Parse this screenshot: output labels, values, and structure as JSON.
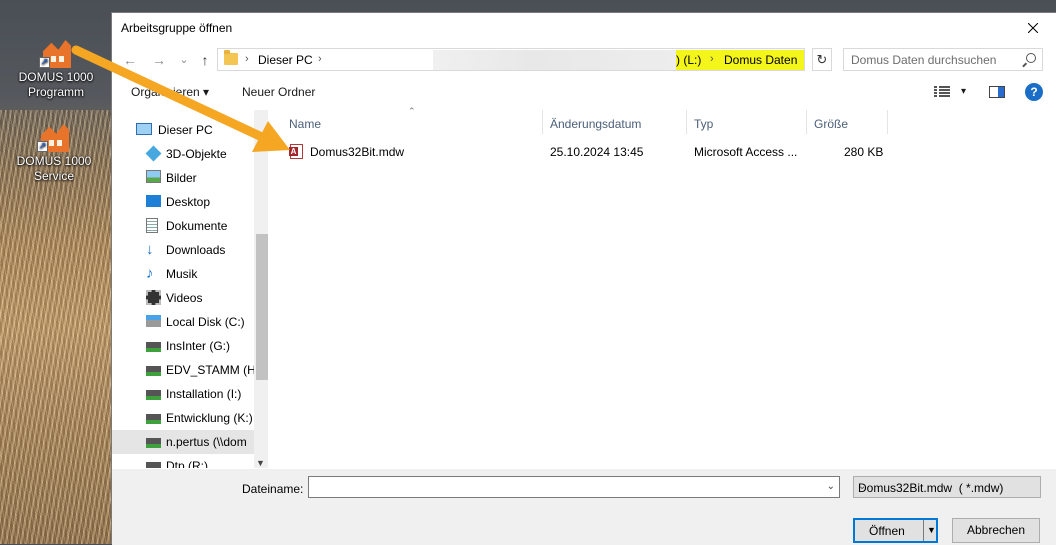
{
  "desktop": {
    "icons": [
      {
        "label_line1": "DOMUS 1000",
        "label_line2": "Programm"
      },
      {
        "label_line1": "DOMUS 1000 Service",
        "label_line2": ""
      }
    ]
  },
  "dialog": {
    "title": "Arbeitsgruppe öffnen",
    "nav": {
      "back": "←",
      "forward": "→",
      "history": "⌄",
      "up": "↑"
    },
    "address": {
      "crumbs": [
        "Dieser PC",
        ") (L:)",
        "Domus Daten"
      ],
      "separator": "›",
      "highlight_color": "#f4f51a"
    },
    "search": {
      "placeholder": "Domus Daten durchsuchen"
    },
    "toolbar": {
      "organize": "Organisieren",
      "new_folder": "Neuer Ordner",
      "help": "?"
    },
    "nav_pane": {
      "items": [
        {
          "label": "Dieser PC",
          "icon": "pc-icon"
        },
        {
          "label": "3D-Objekte",
          "icon": "3d-objects-icon"
        },
        {
          "label": "Bilder",
          "icon": "pictures-icon"
        },
        {
          "label": "Desktop",
          "icon": "desktop-icon"
        },
        {
          "label": "Dokumente",
          "icon": "documents-icon"
        },
        {
          "label": "Downloads",
          "icon": "downloads-icon"
        },
        {
          "label": "Musik",
          "icon": "music-icon"
        },
        {
          "label": "Videos",
          "icon": "videos-icon"
        },
        {
          "label": "Local Disk (C:)",
          "icon": "local-disk-icon"
        },
        {
          "label": "InsInter (G:)",
          "icon": "network-drive-icon"
        },
        {
          "label": "EDV_STAMM (H:",
          "icon": "network-drive-icon"
        },
        {
          "label": "Installation (I:)",
          "icon": "network-drive-icon"
        },
        {
          "label": "Entwicklung (K:)",
          "icon": "network-drive-icon"
        },
        {
          "label": "n.pertus (\\\\dom",
          "icon": "network-drive-icon"
        },
        {
          "label": "Dtp (R:)",
          "icon": "network-drive-icon"
        }
      ]
    },
    "columns": {
      "name": "Name",
      "date": "Änderungsdatum",
      "type": "Typ",
      "size": "Größe"
    },
    "files": [
      {
        "name": "Domus32Bit.mdw",
        "date": "25.10.2024 13:45",
        "type": "Microsoft Access ...",
        "size": "280 KB",
        "icon": "access-file-icon"
      }
    ],
    "footer": {
      "filename_label": "Dateiname:",
      "filename_value": "",
      "filetype": "Domus32Bit.mdw  ( *.mdw)",
      "open": "Öffnen",
      "cancel": "Abbrechen"
    }
  },
  "annotation": {
    "arrow_color": "#f5a623"
  }
}
